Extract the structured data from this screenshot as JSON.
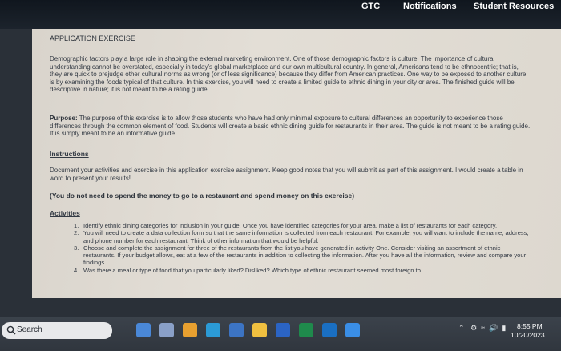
{
  "nav": {
    "gtc": "GTC",
    "notifications": "Notifications",
    "student_resources": "Student Resources"
  },
  "document": {
    "title": "APPLICATION EXERCISE",
    "intro": "Demographic factors play a large role in shaping the external marketing environment. One of those demographic factors is culture. The importance of cultural understanding cannot be overstated, especially in today's global marketplace and our own multicultural country. In general, Americans tend to be ethnocentric; that is, they are quick to prejudge other cultural norms as wrong (or of less significance) because they differ from American practices. One way to be exposed to another culture is by examining the foods typical of that culture. In this exercise, you will need to create a limited guide to ethnic dining in your city or area. The finished guide will be descriptive in nature; it is not meant to be a rating guide.",
    "purpose_label": "Purpose:",
    "purpose_text": " The purpose of this exercise is to allow those students who have had only minimal exposure to cultural differences an opportunity to experience those differences through the common element of food. Students will create a basic ethnic dining guide for restaurants in their area. The guide is not meant to be a rating guide. It is simply meant to be an informative guide.",
    "instructions_heading": "Instructions",
    "instructions_text": "Document your activities and exercise in this application exercise assignment. Keep good notes that you will submit as part of this assignment. I would create a table in word to present your results!",
    "note": "(You do not need to spend the money to go to a restaurant and spend money on this exercise)",
    "activities_heading": "Activities",
    "activities": [
      {
        "num": "1.",
        "text": "Identify ethnic dining categories for inclusion in your guide. Once you have identified categories for your area, make a list of restaurants for each category."
      },
      {
        "num": "2.",
        "text": "You will need to create a data collection form so that the same information is collected from each restaurant. For example, you will want to include the name, address, and phone number for each restaurant. Think of other information that would be helpful."
      },
      {
        "num": "3.",
        "text": "Choose and complete the assignment for three of the restaurants from the list you have generated in activity One. Consider visiting an assortment of ethnic restaurants. If your budget allows, eat at a few of the restaurants in addition to collecting the information. After you have all the information, review and compare your findings."
      },
      {
        "num": "4.",
        "text": "Was there a meal or type of food that you particularly liked? Disliked? Which type of ethnic restaurant seemed most foreign to"
      }
    ]
  },
  "taskbar": {
    "search_label": "Search",
    "time": "8:55 PM",
    "date": "10/20/2023",
    "icons": [
      "file-explorer-icon",
      "chat-icon",
      "app-icon",
      "edge-icon",
      "store-icon",
      "folder-icon",
      "word-icon",
      "excel-icon",
      "outlook-icon",
      "mail-icon"
    ],
    "icon_colors": [
      "#4a88d8",
      "#8aa0c8",
      "#e8a030",
      "#2b9ad6",
      "#3c74c4",
      "#f0c040",
      "#2b64c4",
      "#1f8a4c",
      "#1a6fc2",
      "#3a8ee6"
    ]
  }
}
